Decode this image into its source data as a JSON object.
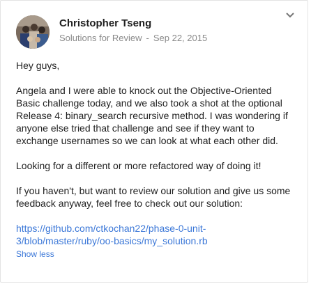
{
  "post": {
    "author": "Christopher Tseng",
    "category": "Solutions for Review",
    "separator": "-",
    "date": "Sep 22, 2015",
    "greeting": "Hey guys,",
    "paragraph1": "Angela and I were able to knock out the Objective-Oriented Basic challenge today, and we also took a shot at the optional Release 4: binary_search recursive method. I was wondering if anyone else tried that challenge and see if they want to exchange usernames so we can look at what each other did.",
    "paragraph2": "Looking for a different or more refactored way of doing it!",
    "paragraph3": "If you haven't, but want to review our solution and give us some feedback anyway, feel free to check out our solution:",
    "link_text": "https://github.com/ctkochan22/phase-0-unit-3/blob/master/ruby/oo-basics/my_solution.rb",
    "show_less": "Show less"
  },
  "icons": {
    "menu": "chevron-down-icon",
    "avatar": "group-photo-avatar"
  },
  "colors": {
    "link": "#3c78d8",
    "meta": "#8a8a8a",
    "text": "#212121"
  }
}
